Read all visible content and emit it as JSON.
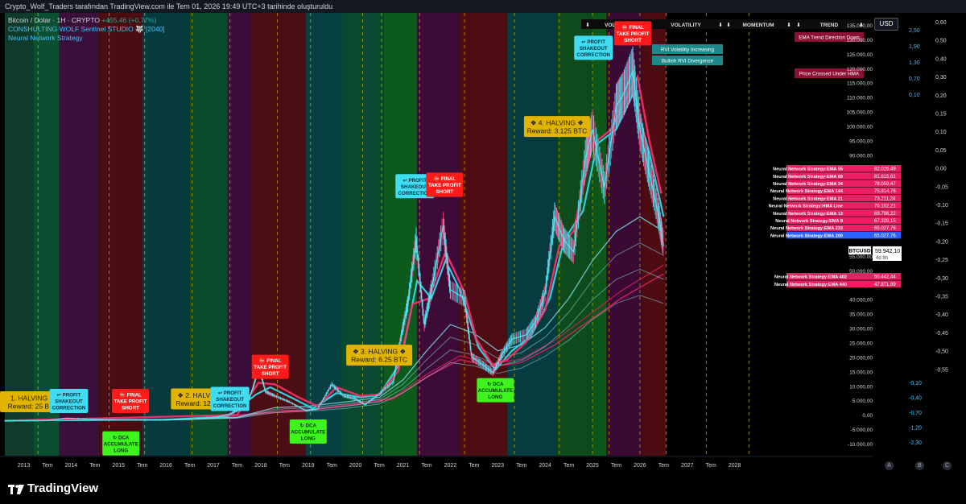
{
  "header": {
    "caption": "Crypto_Wolf_Traders tarafından TradingView.com ile Tem 01, 2026 19:49 UTC+3 tarihinde oluşturuldu",
    "symbol": "Bitcoin / Dolar · 1H · CRYPTO",
    "change": "+455,46 (+0,77%)",
    "indicator1": "CONSHULTING WOLF Sentinel STUDIO 🐺 [2040]",
    "indicator2": "Neural Network Strategy",
    "currency_button": "USD"
  },
  "brand": {
    "name": "TradingView"
  },
  "panel": {
    "headers": [
      "VOLUME",
      "VOLATILITY",
      "MOMENTUM",
      "TREND"
    ],
    "arrows": [
      "⬇",
      "⬇",
      "⬇",
      "⬇",
      "⬇",
      "⬇",
      "⬇",
      "⬇"
    ],
    "badges": [
      "RVI Volatility Increasing",
      "Bullish RVI Divergence",
      "EMA Trend Direction Down",
      "Price Crossed Under HMA"
    ]
  },
  "price_tag": {
    "label": "BTCUSD",
    "value": "59.942,10",
    "countdown": "4d 8h"
  },
  "price_scale_right": [
    "0,60",
    "0,50",
    "0,40",
    "0,30",
    "0,20",
    "0,15",
    "0,10",
    "0,05",
    "0,00",
    "-0,05",
    "-0,10",
    "-0,15",
    "-0,20",
    "-0,25",
    "-0,30",
    "-0,35",
    "-0,40",
    "-0,45",
    "-0,50",
    "-0,55"
  ],
  "price_scale_mid_top": [
    "2,50",
    "1,90",
    "1,30",
    "0,70",
    "0,10"
  ],
  "price_scale_mid_bottom": [
    "-0,10",
    "-0,40",
    "-0,70",
    "-1,20",
    "-2,30"
  ],
  "price_scale_left": [
    "135.000,00",
    "130.000,00",
    "125.000,00",
    "120.000,00",
    "115.000,00",
    "110.000,00",
    "105.000,00",
    "100.000,00",
    "95.000,00",
    "90.000,00",
    "55.000,00",
    "50.000,00",
    "45.000,00",
    "40.000,00",
    "35.000,00",
    "30.000,00",
    "25.000,00",
    "20.000,00",
    "15.000,00",
    "10.000,00",
    "5.000,00",
    "0,00",
    "-5.000,00",
    "-10.000,00"
  ],
  "ema_labels": [
    {
      "name": "Neural Network Strategy:EMA 55",
      "value": "82.026,49",
      "color": "#e91e63"
    },
    {
      "name": "Neural Network Strategy:EMA 89",
      "value": "81.615,61",
      "color": "#e91e63"
    },
    {
      "name": "Neural Network Strategy:EMA 34",
      "value": "78.059,47",
      "color": "#e91e63"
    },
    {
      "name": "Neural Network Strategy:EMA 144",
      "value": "75.914,76",
      "color": "#e91e63"
    },
    {
      "name": "Neural Network Strategy:EMA 21",
      "value": "73.211,24",
      "color": "#e91e63"
    },
    {
      "name": "Neural Network Strategy:HMA Line",
      "value": "70.102,21",
      "color": "#e91e63"
    },
    {
      "name": "Neural Network Strategy:EMA 13",
      "value": "69.796,22",
      "color": "#e91e63"
    },
    {
      "name": "Neural Network Strategy:EMA 8",
      "value": "67.328,15",
      "color": "#e91e63"
    },
    {
      "name": "Neural Network Strategy:EMA 233",
      "value": "65.027,76",
      "color": "#e91e63"
    },
    {
      "name": "Neural Network Strategy:EMA 200",
      "value": "65.027,76",
      "color": "#2962ff"
    }
  ],
  "ema_labels_low": [
    {
      "name": "Neural Network Strategy:EMA 402",
      "value": "50.442,44",
      "color": "#e91e63"
    },
    {
      "name": "Neural Network Strategy:EMA 440",
      "value": "47.871,99",
      "color": "#e91e63"
    }
  ],
  "scale_letters": [
    "A",
    "B",
    "C"
  ],
  "chart_data": {
    "type": "line",
    "x_ticks": [
      "2013",
      "Tem",
      "2014",
      "Tem",
      "2015",
      "Tem",
      "2016",
      "Tem",
      "2017",
      "Tem",
      "2018",
      "Tem",
      "2019",
      "Tem",
      "2020",
      "Tem",
      "2021",
      "Tem",
      "2022",
      "Tem",
      "2023",
      "Tem",
      "2024",
      "Tem",
      "2025",
      "Tem",
      "2026",
      "Tem",
      "2027",
      "Tem",
      "2028"
    ],
    "ylim": [
      -12000,
      140000
    ],
    "x_range": [
      2012.6,
      2028.6
    ],
    "price": [
      [
        2012.6,
        0
      ],
      [
        2013.5,
        100
      ],
      [
        2013.9,
        900
      ],
      [
        2014.5,
        500
      ],
      [
        2015.0,
        250
      ],
      [
        2015.6,
        250
      ],
      [
        2016.0,
        400
      ],
      [
        2016.6,
        650
      ],
      [
        2017.0,
        1000
      ],
      [
        2017.4,
        2500
      ],
      [
        2017.7,
        5000
      ],
      [
        2017.85,
        12000
      ],
      [
        2017.96,
        18500
      ],
      [
        2018.1,
        10000
      ],
      [
        2018.3,
        8500
      ],
      [
        2018.6,
        6500
      ],
      [
        2018.95,
        3500
      ],
      [
        2019.2,
        4000
      ],
      [
        2019.5,
        12500
      ],
      [
        2019.75,
        8500
      ],
      [
        2020.0,
        7500
      ],
      [
        2020.2,
        5500
      ],
      [
        2020.5,
        9200
      ],
      [
        2020.8,
        13500
      ],
      [
        2020.95,
        28000
      ],
      [
        2021.1,
        40000
      ],
      [
        2021.28,
        62000
      ],
      [
        2021.45,
        33000
      ],
      [
        2021.6,
        45000
      ],
      [
        2021.85,
        67000
      ],
      [
        2022.0,
        45000
      ],
      [
        2022.3,
        42000
      ],
      [
        2022.45,
        22000
      ],
      [
        2022.7,
        19000
      ],
      [
        2022.9,
        16500
      ],
      [
        2023.1,
        23000
      ],
      [
        2023.3,
        28000
      ],
      [
        2023.6,
        29500
      ],
      [
        2023.8,
        34000
      ],
      [
        2024.0,
        44000
      ],
      [
        2024.2,
        70000
      ],
      [
        2024.4,
        62000
      ],
      [
        2024.6,
        58000
      ],
      [
        2024.85,
        90000
      ],
      [
        2025.0,
        100000
      ],
      [
        2025.25,
        80000
      ],
      [
        2025.5,
        108000
      ],
      [
        2025.65,
        112000
      ],
      [
        2025.85,
        120000
      ],
      [
        2026.0,
        100000
      ],
      [
        2026.2,
        85000
      ],
      [
        2026.4,
        70000
      ],
      [
        2026.5,
        59942
      ]
    ],
    "ema_fast": [
      [
        2012.6,
        0
      ],
      [
        2014.0,
        300
      ],
      [
        2016.0,
        350
      ],
      [
        2017.3,
        1500
      ],
      [
        2017.9,
        9000
      ],
      [
        2018.2,
        11500
      ],
      [
        2018.7,
        7500
      ],
      [
        2019.1,
        4200
      ],
      [
        2019.6,
        9500
      ],
      [
        2020.1,
        8000
      ],
      [
        2020.5,
        8800
      ],
      [
        2020.95,
        20000
      ],
      [
        2021.3,
        48000
      ],
      [
        2021.6,
        42000
      ],
      [
        2021.9,
        55000
      ],
      [
        2022.2,
        45000
      ],
      [
        2022.6,
        25000
      ],
      [
        2022.95,
        17500
      ],
      [
        2023.3,
        24000
      ],
      [
        2023.7,
        29000
      ],
      [
        2024.1,
        42000
      ],
      [
        2024.4,
        62000
      ],
      [
        2024.8,
        72000
      ],
      [
        2025.1,
        95000
      ],
      [
        2025.5,
        100000
      ],
      [
        2025.85,
        112000
      ],
      [
        2026.2,
        92000
      ],
      [
        2026.5,
        70000
      ]
    ],
    "ema_slow": [
      [
        2012.6,
        0
      ],
      [
        2016.0,
        300
      ],
      [
        2017.5,
        1200
      ],
      [
        2018.3,
        4500
      ],
      [
        2019.0,
        5000
      ],
      [
        2019.8,
        6500
      ],
      [
        2020.5,
        8000
      ],
      [
        2021.0,
        14000
      ],
      [
        2021.5,
        24000
      ],
      [
        2022.0,
        33000
      ],
      [
        2022.5,
        30000
      ],
      [
        2023.0,
        24000
      ],
      [
        2023.5,
        26000
      ],
      [
        2024.0,
        32000
      ],
      [
        2024.5,
        42000
      ],
      [
        2025.0,
        55000
      ],
      [
        2025.5,
        65000
      ],
      [
        2026.0,
        70000
      ],
      [
        2026.5,
        65000
      ]
    ],
    "ema_long": [
      [
        2012.6,
        0
      ],
      [
        2016.5,
        400
      ],
      [
        2018.0,
        2500
      ],
      [
        2019.0,
        3500
      ],
      [
        2020.0,
        5500
      ],
      [
        2020.8,
        7500
      ],
      [
        2021.5,
        15000
      ],
      [
        2022.2,
        21000
      ],
      [
        2022.9,
        18500
      ],
      [
        2023.5,
        20000
      ],
      [
        2024.2,
        26000
      ],
      [
        2024.9,
        34000
      ],
      [
        2025.6,
        42000
      ],
      [
        2026.5,
        50442
      ]
    ],
    "hma_pink": [
      [
        2012.6,
        0
      ],
      [
        2017.5,
        2000
      ],
      [
        2017.95,
        13000
      ],
      [
        2018.3,
        12500
      ],
      [
        2018.8,
        8000
      ],
      [
        2019.2,
        5000
      ],
      [
        2019.6,
        11500
      ],
      [
        2020.1,
        8500
      ],
      [
        2020.5,
        9000
      ],
      [
        2020.9,
        17000
      ],
      [
        2021.2,
        40000
      ],
      [
        2021.55,
        42000
      ],
      [
        2021.9,
        58000
      ],
      [
        2022.3,
        44000
      ],
      [
        2022.55,
        28000
      ],
      [
        2022.9,
        19000
      ],
      [
        2023.2,
        21000
      ],
      [
        2023.6,
        27000
      ],
      [
        2024.0,
        38000
      ],
      [
        2024.3,
        60000
      ],
      [
        2024.6,
        65000
      ],
      [
        2025.0,
        95000
      ],
      [
        2025.4,
        100000
      ],
      [
        2025.75,
        112000
      ],
      [
        2025.95,
        118000
      ],
      [
        2026.2,
        96000
      ],
      [
        2026.45,
        78000
      ]
    ],
    "annotations": [
      {
        "x": 2012.6,
        "y": 6500,
        "kind": "halving",
        "lines": [
          "1. HALVING ❖",
          "Reward: 25 BTC"
        ]
      },
      {
        "x": 2013.95,
        "y": 6800,
        "kind": "profit",
        "lines": [
          "↩ PROFIT",
          "SHAKEOUT",
          "CORRECTION"
        ]
      },
      {
        "x": 2015.25,
        "y": 6800,
        "kind": "final",
        "lines": [
          "⛔ FINAL",
          "TAKE PROFIT",
          "SHORT"
        ]
      },
      {
        "x": 2016.8,
        "y": 7500,
        "kind": "halving",
        "lines": [
          "❖ 2. HALVING ❖",
          "Reward: 12.5 BTC"
        ]
      },
      {
        "x": 2017.35,
        "y": 7500,
        "kind": "profit",
        "lines": [
          "↩ PROFIT",
          "SHAKEOUT",
          "CORRECTION"
        ]
      },
      {
        "x": 2018.2,
        "y": 18500,
        "kind": "final",
        "lines": [
          "⛔ FINAL",
          "TAKE PROFIT",
          "SHORT"
        ]
      },
      {
        "x": 2015.05,
        "y": -7800,
        "kind": "dca",
        "lines": [
          "↻ DCA",
          "ACCUMULATE",
          "LONG"
        ]
      },
      {
        "x": 2019.0,
        "y": -3700,
        "kind": "dca",
        "lines": [
          "↻ DCA",
          "ACCUMULATE",
          "LONG"
        ]
      },
      {
        "x": 2020.5,
        "y": 22500,
        "kind": "halving",
        "lines": [
          "❖ 3. HALVING ❖",
          "Reward: 6.25 BTC"
        ]
      },
      {
        "x": 2021.25,
        "y": 80500,
        "kind": "profit",
        "lines": [
          "↩ PROFIT",
          "SHAKEOUT",
          "CORRECTION"
        ]
      },
      {
        "x": 2021.88,
        "y": 81000,
        "kind": "final",
        "lines": [
          "⛔ FINAL",
          "TAKE PROFIT",
          "SHORT"
        ]
      },
      {
        "x": 2022.95,
        "y": 10500,
        "kind": "dca",
        "lines": [
          "↻ DCA",
          "ACCUMULATE",
          "LONG"
        ]
      },
      {
        "x": 2024.25,
        "y": 101000,
        "kind": "halving",
        "lines": [
          "❖ 4. HALVING ❖",
          "Reward: 3.125 BTC"
        ]
      },
      {
        "x": 2025.02,
        "y": 128000,
        "kind": "profit",
        "lines": [
          "↩ PROFIT",
          "SHAKEOUT",
          "CORRECTION"
        ]
      },
      {
        "x": 2025.85,
        "y": 133000,
        "kind": "final",
        "lines": [
          "⛔ FINAL",
          "TAKE PROFIT",
          "SHORT"
        ]
      }
    ],
    "bands": [
      [
        2012.6,
        2013.2,
        "#103a2a"
      ],
      [
        2013.2,
        2013.75,
        "#0b4f33"
      ],
      [
        2013.75,
        2014.6,
        "#3a0f3a"
      ],
      [
        2014.6,
        2015.5,
        "#4a0d12"
      ],
      [
        2015.5,
        2016.5,
        "#063a3f"
      ],
      [
        2016.5,
        2017.3,
        "#0c4a2c"
      ],
      [
        2017.3,
        2017.8,
        "#3a0d3a"
      ],
      [
        2017.8,
        2018.95,
        "#4a0e14"
      ],
      [
        2018.95,
        2019.7,
        "#064040"
      ],
      [
        2019.7,
        2020.6,
        "#084a2f"
      ],
      [
        2020.6,
        2021.3,
        "#0c5a1c"
      ],
      [
        2021.3,
        2022.2,
        "#3d0c36"
      ],
      [
        2022.2,
        2023.2,
        "#4d0d12"
      ],
      [
        2023.2,
        2024.25,
        "#063c40"
      ],
      [
        2024.25,
        2025.0,
        "#0d4a1c"
      ],
      [
        2025.0,
        2025.3,
        "#0e561a"
      ],
      [
        2025.3,
        2026.05,
        "#3a0a34"
      ],
      [
        2026.05,
        2026.55,
        "#4d0c12"
      ]
    ],
    "vlines": [
      2013.3,
      2014.8,
      2015.55,
      2016.55,
      2017.35,
      2018.35,
      2019.05,
      2020.15,
      2020.55,
      2021.35,
      2022.3,
      2023.35,
      2024.3,
      2025.0,
      2025.35,
      2026.0,
      2026.55,
      2027.4,
      2028.3
    ]
  }
}
